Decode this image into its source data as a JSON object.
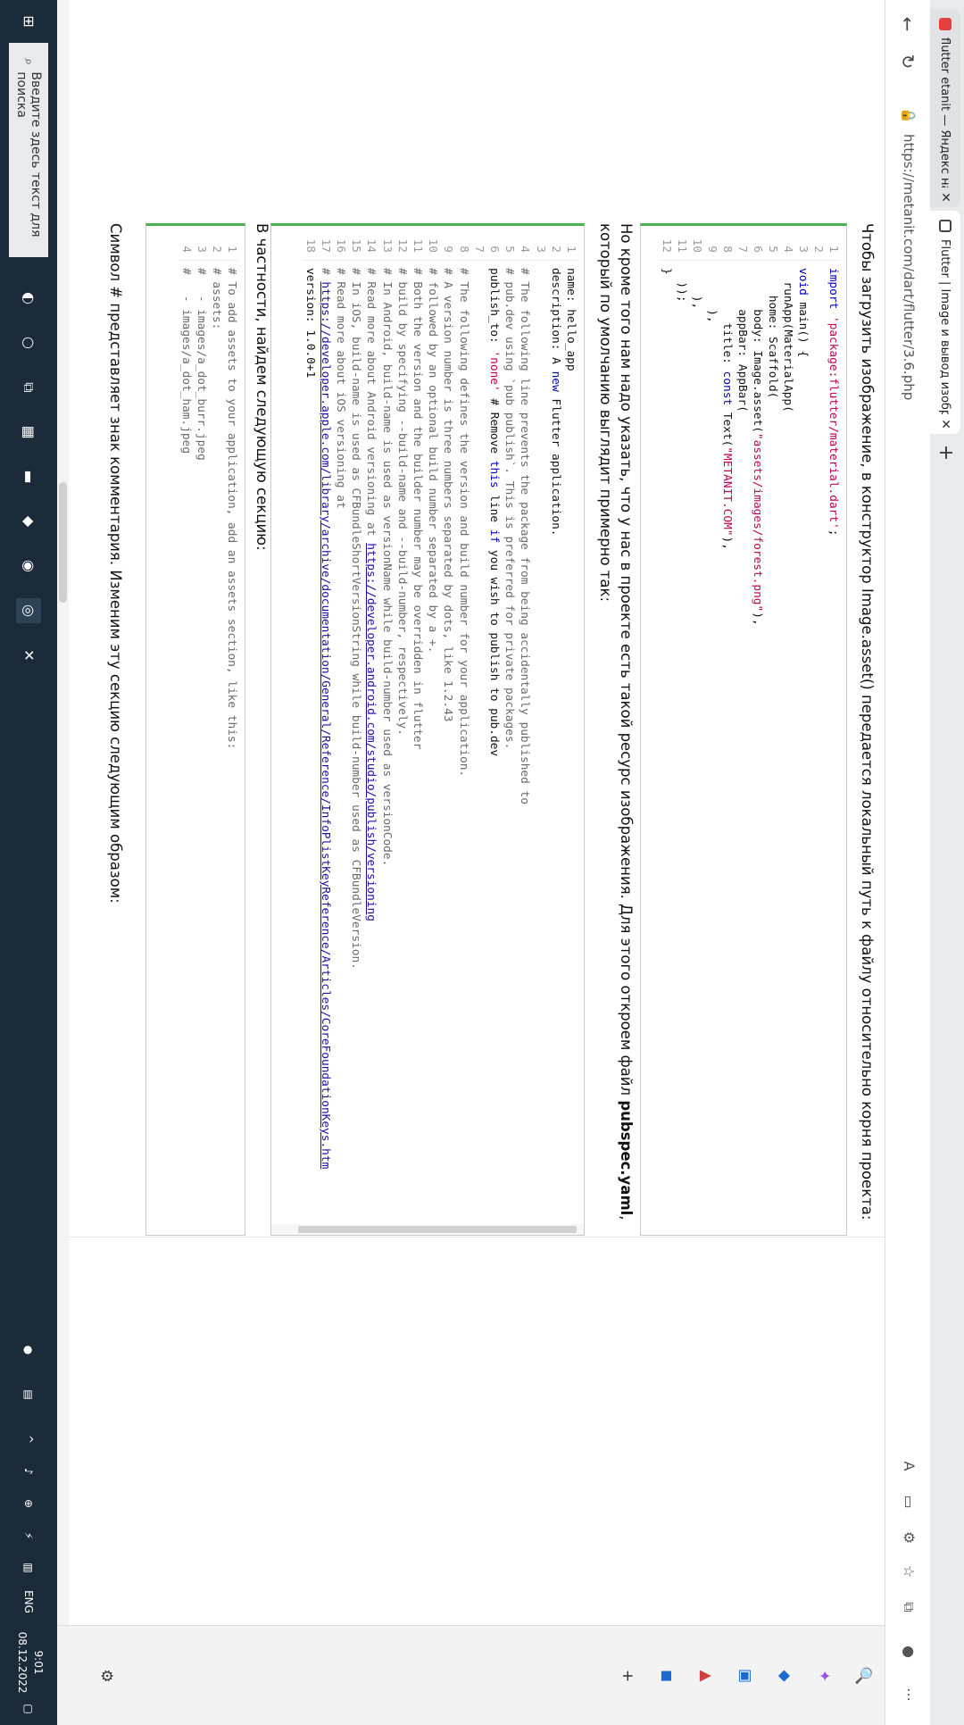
{
  "browser": {
    "tabs": [
      {
        "label": "flutter etanit — Яндекс нашлось",
        "close": "✕"
      },
      {
        "label": "Flutter | Image и вывод изображения",
        "close": "✕"
      }
    ],
    "new_tab": "+",
    "address": "https://metanit.com/dart/flutter/3.6.php"
  },
  "article": {
    "intro_text": "Чтобы загрузить изображение, в конструктор Image.asset() передается локальный путь к файлу относительно корня проекта:",
    "pubspec_text_part1": "Но кроме того нам надо указать, что у нас в проекте есть такой ресурс изображения. Для этого откроем файл ",
    "pubspec_text_bold": "pubspec.yaml",
    "pubspec_text_part2": ", который по умолчанию выглядит примерно так:",
    "section_text": "В частности, найдем следующую секцию:",
    "comment_text": "Символ # представляет знак комментария. Изменим эту секцию следующим образом:"
  },
  "code_main": [
    {
      "n": "1",
      "parts": [
        {
          "t": "import ",
          "c": "kw"
        },
        {
          "t": "'package:flutter/material.dart'",
          "c": "str"
        },
        {
          "t": ";",
          "c": ""
        }
      ]
    },
    {
      "n": "2",
      "parts": []
    },
    {
      "n": "3",
      "parts": [
        {
          "t": "void ",
          "c": "kw"
        },
        {
          "t": "main() {",
          "c": ""
        }
      ]
    },
    {
      "n": "4",
      "parts": [
        {
          "t": "  runApp(MaterialApp(",
          "c": ""
        }
      ]
    },
    {
      "n": "5",
      "parts": [
        {
          "t": "    home: Scaffold(",
          "c": ""
        }
      ]
    },
    {
      "n": "6",
      "parts": [
        {
          "t": "      body: Image.asset(",
          "c": ""
        },
        {
          "t": "\"assets/images/forest.png\"",
          "c": "str"
        },
        {
          "t": "),",
          "c": ""
        }
      ]
    },
    {
      "n": "7",
      "parts": [
        {
          "t": "      appBar: AppBar(",
          "c": ""
        }
      ]
    },
    {
      "n": "8",
      "parts": [
        {
          "t": "        title: ",
          "c": ""
        },
        {
          "t": "const ",
          "c": "kw"
        },
        {
          "t": "Text(",
          "c": ""
        },
        {
          "t": "\"METANIT.COM\"",
          "c": "str"
        },
        {
          "t": "),",
          "c": ""
        }
      ]
    },
    {
      "n": "9",
      "parts": [
        {
          "t": "      ),",
          "c": ""
        }
      ]
    },
    {
      "n": "10",
      "parts": [
        {
          "t": "    ),",
          "c": ""
        }
      ]
    },
    {
      "n": "11",
      "parts": [
        {
          "t": "  ));",
          "c": ""
        }
      ]
    },
    {
      "n": "12",
      "parts": [
        {
          "t": "}",
          "c": ""
        }
      ]
    }
  ],
  "code_pubspec": [
    {
      "n": "1",
      "parts": [
        {
          "t": "name: hello_app",
          "c": ""
        }
      ]
    },
    {
      "n": "2",
      "parts": [
        {
          "t": "description: A ",
          "c": ""
        },
        {
          "t": "new",
          "c": "kw"
        },
        {
          "t": " Flutter application.",
          "c": ""
        }
      ]
    },
    {
      "n": "3",
      "parts": []
    },
    {
      "n": "4",
      "parts": [
        {
          "t": "# The following line prevents the package from being accidentally published to",
          "c": "cm"
        }
      ]
    },
    {
      "n": "5",
      "parts": [
        {
          "t": "# pub.dev using `pub publish`. This is preferred for private packages.",
          "c": "cm"
        }
      ]
    },
    {
      "n": "6",
      "parts": [
        {
          "t": "publish_to: ",
          "c": ""
        },
        {
          "t": "'none'",
          "c": "str"
        },
        {
          "t": " # Remove ",
          "c": ""
        },
        {
          "t": "this",
          "c": "kw"
        },
        {
          "t": " line ",
          "c": ""
        },
        {
          "t": "if",
          "c": "kw"
        },
        {
          "t": " you wish to publish to pub.dev",
          "c": ""
        }
      ]
    },
    {
      "n": "7",
      "parts": []
    },
    {
      "n": "8",
      "parts": [
        {
          "t": "# The following defines the version and build number for your application.",
          "c": "cm"
        }
      ]
    },
    {
      "n": "9",
      "parts": [
        {
          "t": "# A version number is three numbers separated by dots, like 1.2.43",
          "c": "cm"
        }
      ]
    },
    {
      "n": "10",
      "parts": [
        {
          "t": "# followed by an optional build number separated by a +.",
          "c": "cm"
        }
      ]
    },
    {
      "n": "11",
      "parts": [
        {
          "t": "# Both the version and the builder number may be overridden in flutter",
          "c": "cm"
        }
      ]
    },
    {
      "n": "12",
      "parts": [
        {
          "t": "# build by specifying --build-name and --build-number, respectively.",
          "c": "cm"
        }
      ]
    },
    {
      "n": "13",
      "parts": [
        {
          "t": "# In Android, build-name is used as versionName while build-number used as versionCode.",
          "c": "cm"
        }
      ]
    },
    {
      "n": "14",
      "parts": [
        {
          "t": "# Read more about Android versioning at ",
          "c": "cm"
        },
        {
          "t": "https://developer.android.com/studio/publish/versioning",
          "c": "lnk"
        }
      ]
    },
    {
      "n": "15",
      "parts": [
        {
          "t": "# In iOS, build-name is used as CFBundleShortVersionString while build-number used as CFBundleVersion.",
          "c": "cm"
        }
      ]
    },
    {
      "n": "16",
      "parts": [
        {
          "t": "# Read more about iOS versioning at",
          "c": "cm"
        }
      ]
    },
    {
      "n": "17",
      "parts": [
        {
          "t": "# ",
          "c": "cm"
        },
        {
          "t": "https://developer.apple.com/library/archive/documentation/General/Reference/InfoPlistKeyReference/Articles/CoreFoundationKeys.htm",
          "c": "lnk"
        }
      ]
    },
    {
      "n": "18",
      "parts": [
        {
          "t": "version: 1.0.0+1",
          "c": ""
        }
      ]
    }
  ],
  "code_assets": [
    {
      "n": "1",
      "parts": [
        {
          "t": "# To add assets to your application, add an assets section, like this:",
          "c": "cm"
        }
      ]
    },
    {
      "n": "2",
      "parts": [
        {
          "t": "# assets:",
          "c": "cm"
        }
      ]
    },
    {
      "n": "3",
      "parts": [
        {
          "t": "#   - images/a_dot_burr.jpeg",
          "c": "cm"
        }
      ]
    },
    {
      "n": "4",
      "parts": [
        {
          "t": "#   - images/a_dot_ham.jpeg",
          "c": "cm"
        }
      ]
    }
  ],
  "taskbar": {
    "search_placeholder": "Введите здесь текст для поиска",
    "lang": "ENG",
    "time": "9:01",
    "date": "08.12.2022"
  },
  "colors": {
    "accent": "#2a6ad0",
    "code_border": "#4cb24c",
    "taskbar": "#1c2b3a"
  }
}
